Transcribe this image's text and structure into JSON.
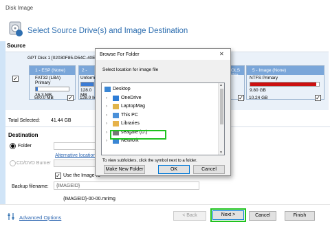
{
  "window": {
    "title": "Disk Image"
  },
  "header": {
    "title": "Select Source Drive(s) and Image Destination"
  },
  "source": {
    "section_label": "Source",
    "disk_label": "GPT Disk 1 [02030F85-D54C-40EB-8B45",
    "partitions": [
      {
        "name": "1 - ESP (None)",
        "type": "FAT32 (LBA) Primary",
        "used": "35.3 MB",
        "total": "500.0 MB",
        "fill": 0.07,
        "color": "#3a7bd5"
      },
      {
        "name": "2 -",
        "type": "Unformat",
        "used": "128.0 MB",
        "total": "128.0 M",
        "fill": 1.0,
        "color": "#3a7bd5"
      },
      {
        "name": "OLS (No",
        "type": "",
        "used": "",
        "total": "",
        "fill": 0,
        "color": "#3a7bd5"
      },
      {
        "name": "5 - Image (None)",
        "type": "NTFS Primary",
        "used": "9.80 GB",
        "total": "10.24 GB",
        "fill": 0.96,
        "color": "#cc1010"
      }
    ],
    "total_selected_label": "Total Selected:",
    "total_selected_value": "41.44 GB"
  },
  "destination": {
    "section_label": "Destination",
    "folder_label": "Folder",
    "alt_locations_link": "Alternative location",
    "cd_label": "CD/DVD Burner",
    "use_image_id_label": "Use the Image ID",
    "backup_filename_label": "Backup filename:",
    "backup_filename_value": "{IMAGEID}",
    "filename_preview": "{IMAGEID}-00-00.mrimg"
  },
  "dialog": {
    "title": "Browse For Folder",
    "close_glyph": "✕",
    "prompt": "Select location for image file",
    "tree": [
      {
        "label": "Desktop",
        "indent": 0,
        "expander": "",
        "icon": "desktop-icon"
      },
      {
        "label": "OneDrive",
        "indent": 1,
        "expander": "›",
        "icon": "onedrive-icon"
      },
      {
        "label": "LaptopMag",
        "indent": 1,
        "expander": "›",
        "icon": "user-folder-icon"
      },
      {
        "label": "This PC",
        "indent": 1,
        "expander": "›",
        "icon": "computer-icon"
      },
      {
        "label": "Libraries",
        "indent": 1,
        "expander": "›",
        "icon": "libraries-icon"
      },
      {
        "label": "seagate  (D:)",
        "indent": 1,
        "expander": "›",
        "icon": "drive-icon"
      },
      {
        "label": "Network",
        "indent": 1,
        "expander": "›",
        "icon": "network-icon"
      }
    ],
    "hint": "To view subfolders, click the symbol next to a folder.",
    "make_new_folder": "Make New Folder",
    "ok": "OK",
    "cancel": "Cancel"
  },
  "footer": {
    "advanced_options": "Advanced Options",
    "back": "< Back",
    "next": "Next >",
    "cancel": "Cancel",
    "finish": "Finish"
  },
  "colors": {
    "accent": "#2f6fb0",
    "highlight": "#1ec21e",
    "partition_head": "#7aa6d9"
  }
}
